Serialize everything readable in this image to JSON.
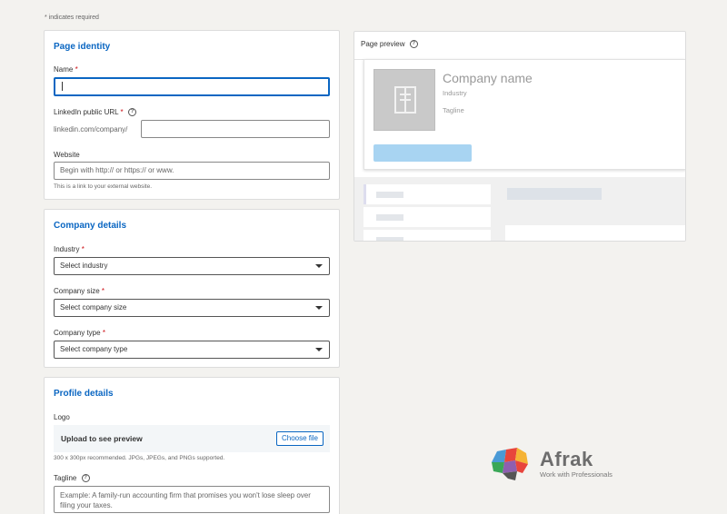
{
  "required_note": "* indicates required",
  "page_identity": {
    "title": "Page identity",
    "name_label": "Name",
    "name_required": "*",
    "url_label": "LinkedIn public URL",
    "url_required": "*",
    "url_prefix": "linkedin.com/company/",
    "url_value": "",
    "website_label": "Website",
    "website_placeholder": "Begin with http:// or https:// or www.",
    "website_helper": "This is a link to your external website."
  },
  "company_details": {
    "title": "Company details",
    "industry_label": "Industry",
    "industry_required": "*",
    "industry_value": "Select industry",
    "size_label": "Company size",
    "size_required": "*",
    "size_value": "Select company size",
    "type_label": "Company type",
    "type_required": "*",
    "type_value": "Select company type"
  },
  "profile_details": {
    "title": "Profile details",
    "logo_label": "Logo",
    "upload_text": "Upload to see preview",
    "choose_file": "Choose file",
    "logo_helper": "300 x 300px recommended. JPGs, JPEGs, and PNGs supported.",
    "tagline_label": "Tagline",
    "tagline_placeholder": "Example: A family-run accounting firm that promises you won't lose sleep over filing your taxes."
  },
  "preview": {
    "title": "Page preview",
    "company_name": "Company name",
    "industry": "Industry",
    "tagline": "Tagline"
  },
  "watermark": {
    "name": "Afrak",
    "tagline": "Work with Professionals"
  },
  "colors": {
    "accent": "#0a66c2",
    "required": "#cc1016",
    "follow_placeholder": "#a8d4f2"
  },
  "icons": [
    "help-icon",
    "building-icon",
    "dropdown-caret-icon",
    "brain-logo-icon"
  ]
}
